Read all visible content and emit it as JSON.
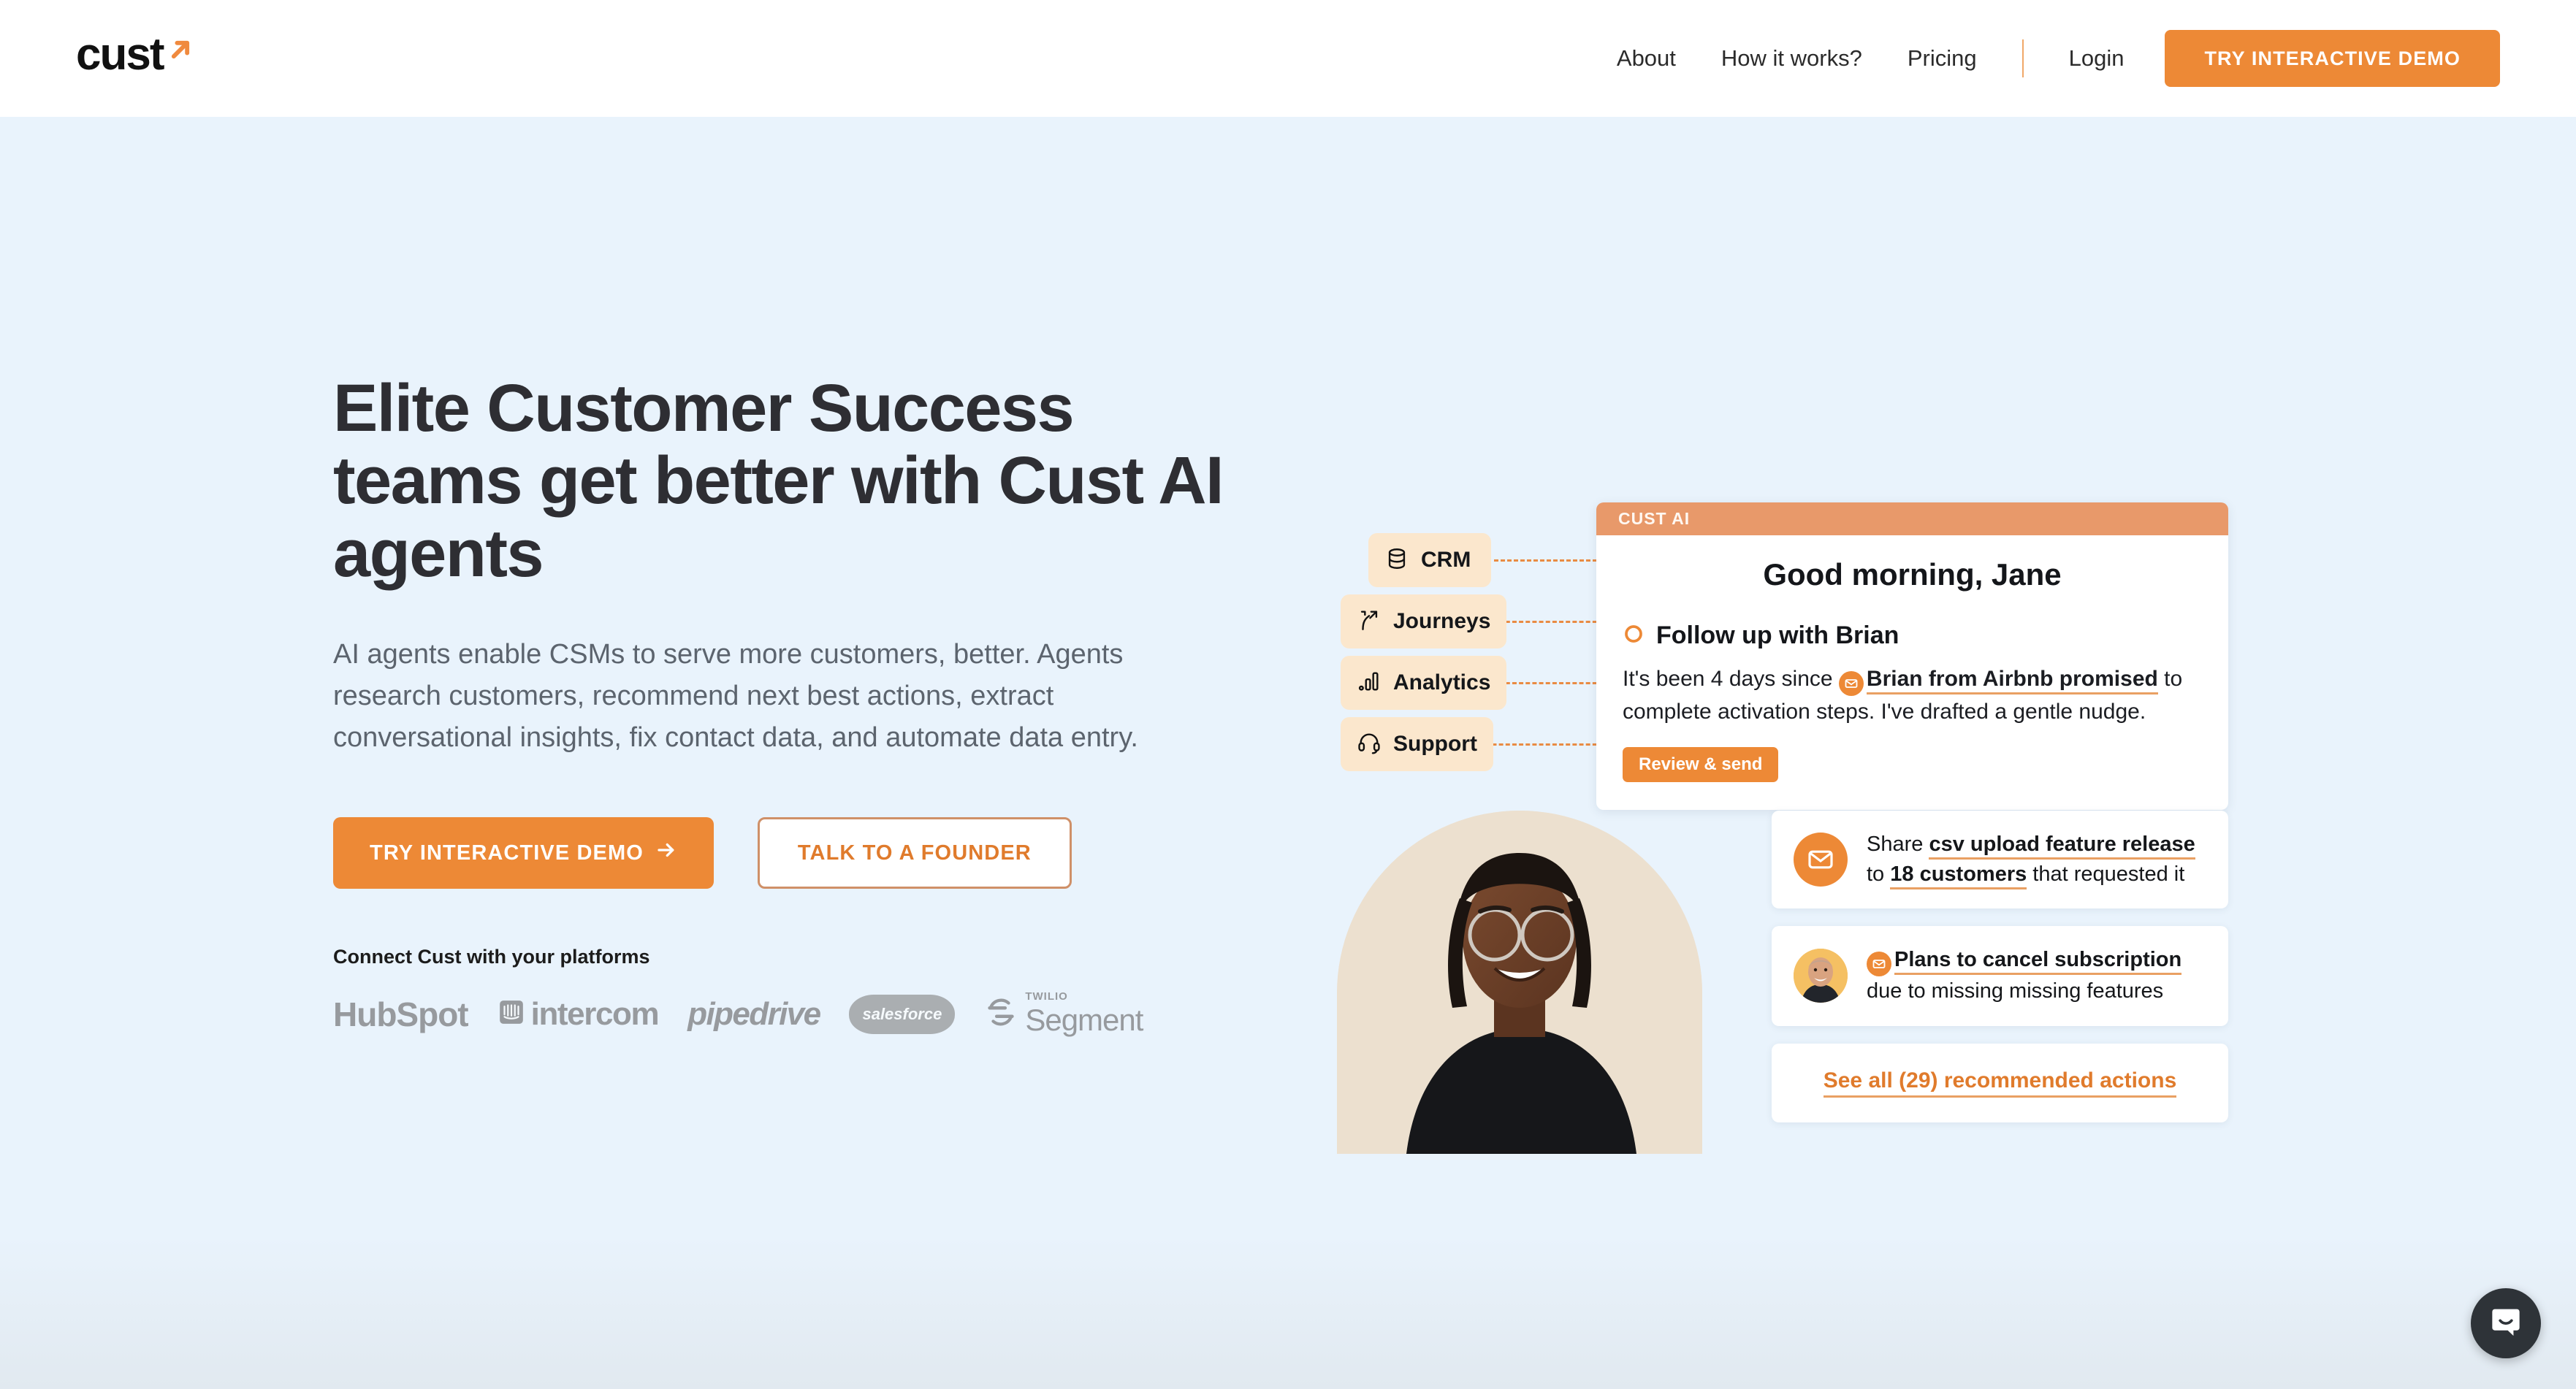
{
  "brand": {
    "logo_text": "cust",
    "logo_icon": "arrow-up-right-icon",
    "accent_orange": "#ED8936",
    "accent_orange_muted": "#E8996A",
    "hero_background": "#E9F3FC",
    "chip_background": "#FBE7CD"
  },
  "header": {
    "nav": [
      {
        "label": "About",
        "name": "nav-link-about"
      },
      {
        "label": "How it works?",
        "name": "nav-link-how-it-works"
      },
      {
        "label": "Pricing",
        "name": "nav-link-pricing"
      }
    ],
    "login_label": "Login",
    "cta_label": "TRY INTERACTIVE DEMO"
  },
  "hero": {
    "headline": "Elite Customer Success teams get better with Cust AI agents",
    "subhead": "AI agents enable CSMs to serve more customers, better. Agents research customers, recommend next best actions, extract conversational insights, fix contact data, and automate data entry.",
    "primary_cta": "TRY INTERACTIVE DEMO",
    "primary_cta_icon": "arrow-right-icon",
    "secondary_cta": "TALK TO A FOUNDER",
    "connect_label": "Connect Cust with your platforms",
    "platform_logos": [
      {
        "label": "HubSpot",
        "name": "logo-hubspot"
      },
      {
        "label": "intercom",
        "name": "logo-intercom"
      },
      {
        "label": "pipedrive",
        "name": "logo-pipedrive"
      },
      {
        "label": "salesforce",
        "name": "logo-salesforce"
      },
      {
        "label": "Segment",
        "sup": "TWILIO",
        "name": "logo-twilio-segment"
      }
    ]
  },
  "integrations": [
    {
      "label": "CRM",
      "icon": "database-icon"
    },
    {
      "label": "Journeys",
      "icon": "branching-arrow-icon"
    },
    {
      "label": "Analytics",
      "icon": "bar-chart-icon"
    },
    {
      "label": "Support",
      "icon": "headset-icon"
    }
  ],
  "ai_card": {
    "header_label": "CUST AI",
    "greeting": "Good morning, Jane",
    "task_status_icon": "circle-outline-icon",
    "task_title": "Follow up with Brian",
    "body_prefix": "It's been 4 days since ",
    "body_link": "Brian from Airbnb promised",
    "body_suffix": " to complete activation steps. I've drafted a gentle nudge.",
    "body_badge_icon": "envelope-icon",
    "button_label": "Review & send"
  },
  "action_cards": [
    {
      "icon": "envelope-icon",
      "icon_type": "envelope",
      "prefix": "Share ",
      "link": "csv upload feature release",
      "middle": " to ",
      "link2": "18 customers",
      "suffix": " that requested it"
    },
    {
      "icon": "avatar",
      "icon_type": "avatar",
      "badge_icon": "envelope-icon",
      "link": "Plans to cancel subscription",
      "suffix": "due to missing missing features"
    }
  ],
  "see_all_label": "See all (29) recommended actions",
  "chat": {
    "icon": "chat-bubble-icon"
  }
}
